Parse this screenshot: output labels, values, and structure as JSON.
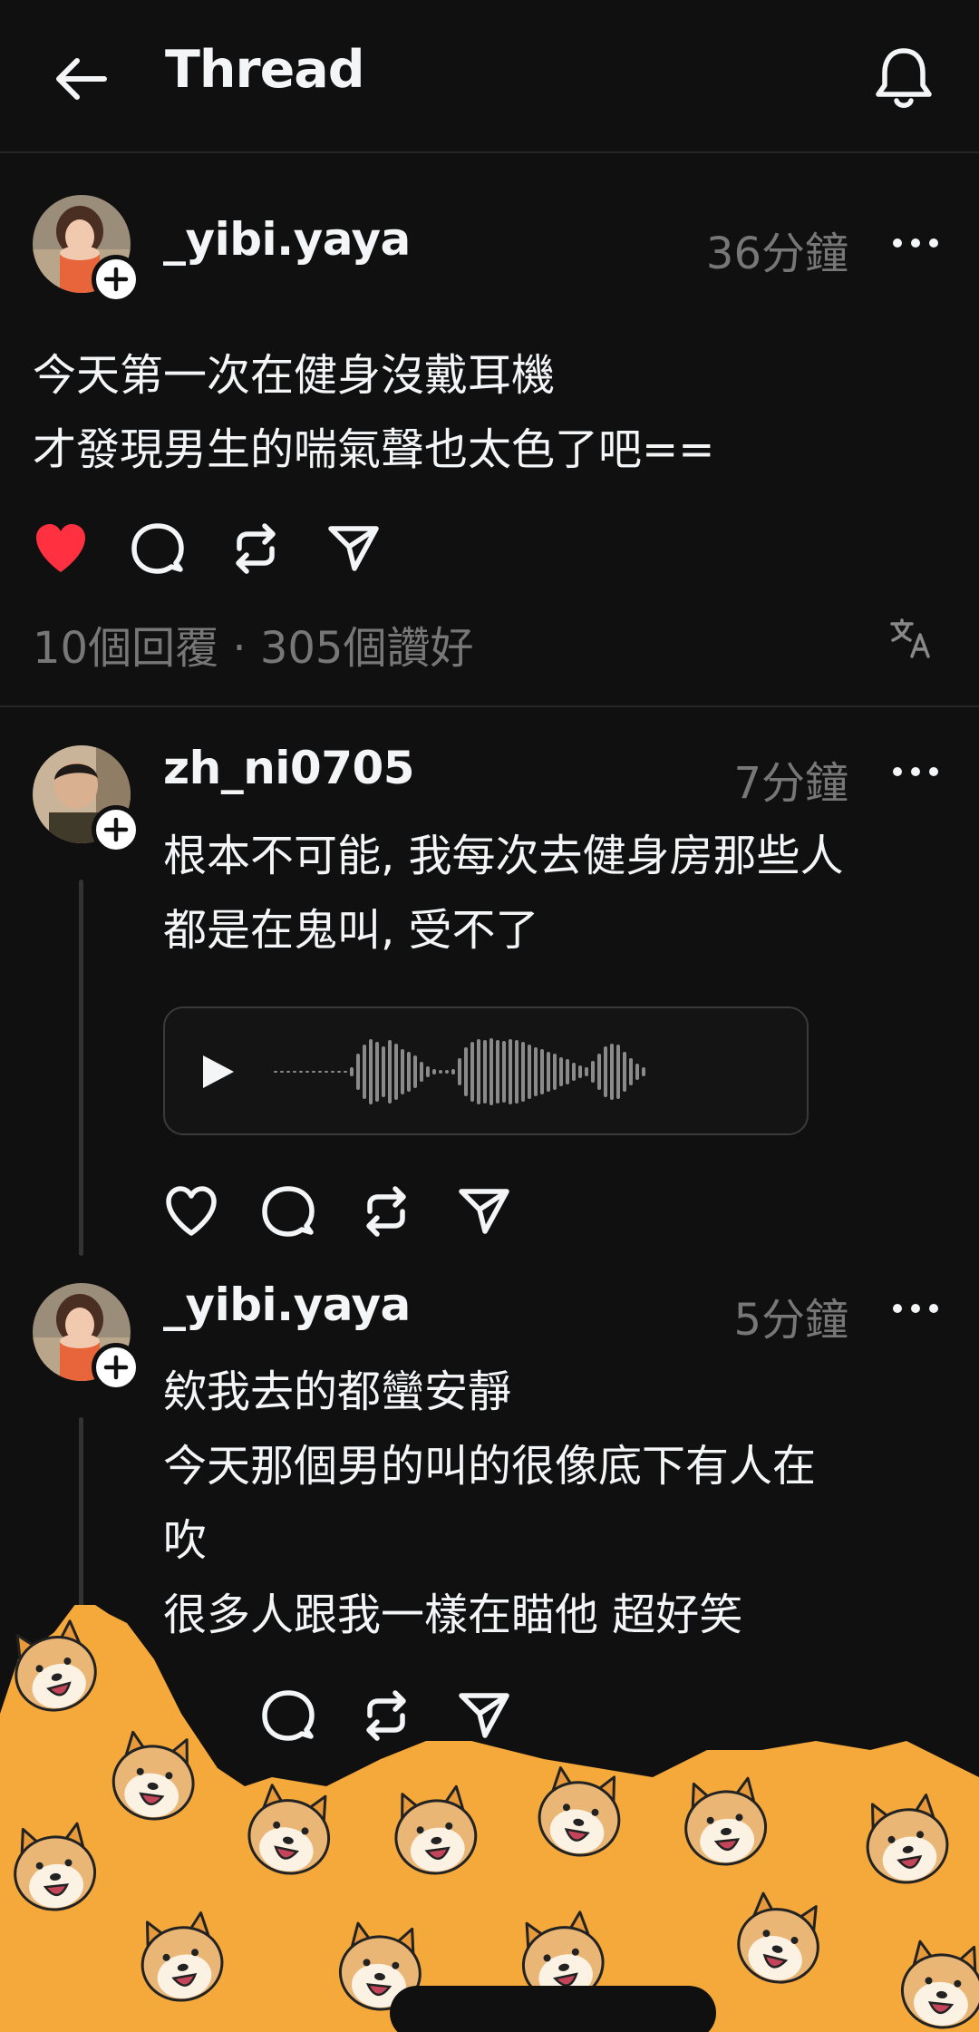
{
  "header": {
    "title": "Thread",
    "back_icon": "arrow-left-icon",
    "bell_icon": "bell-icon"
  },
  "main_post": {
    "username": "_yibi.yaya",
    "time": "36分鐘",
    "line1": "今天第一次在健身沒戴耳機",
    "line2": "才發現男生的喘氣聲也太色了吧==",
    "liked": true,
    "stats": "10個回覆 · 305個讚好",
    "translate_icon": "translate-icon"
  },
  "replies": [
    {
      "username": "zh_ni0705",
      "time": "7分鐘",
      "line1": "根本不可能, 我每次去健身房那些人",
      "line2": "都是在鬼叫, 受不了",
      "has_audio": true
    },
    {
      "username": "_yibi.yaya",
      "time": "5分鐘",
      "line1": "欸我去的都蠻安靜",
      "line2": "今天那個男的叫的很像底下有人在",
      "line3": "吹",
      "line4": "很多人跟我一樣在瞄他 超好笑"
    }
  ],
  "colors": {
    "background": "#101010",
    "like_red": "#ff3040",
    "overlay_orange": "#f5a93a"
  }
}
